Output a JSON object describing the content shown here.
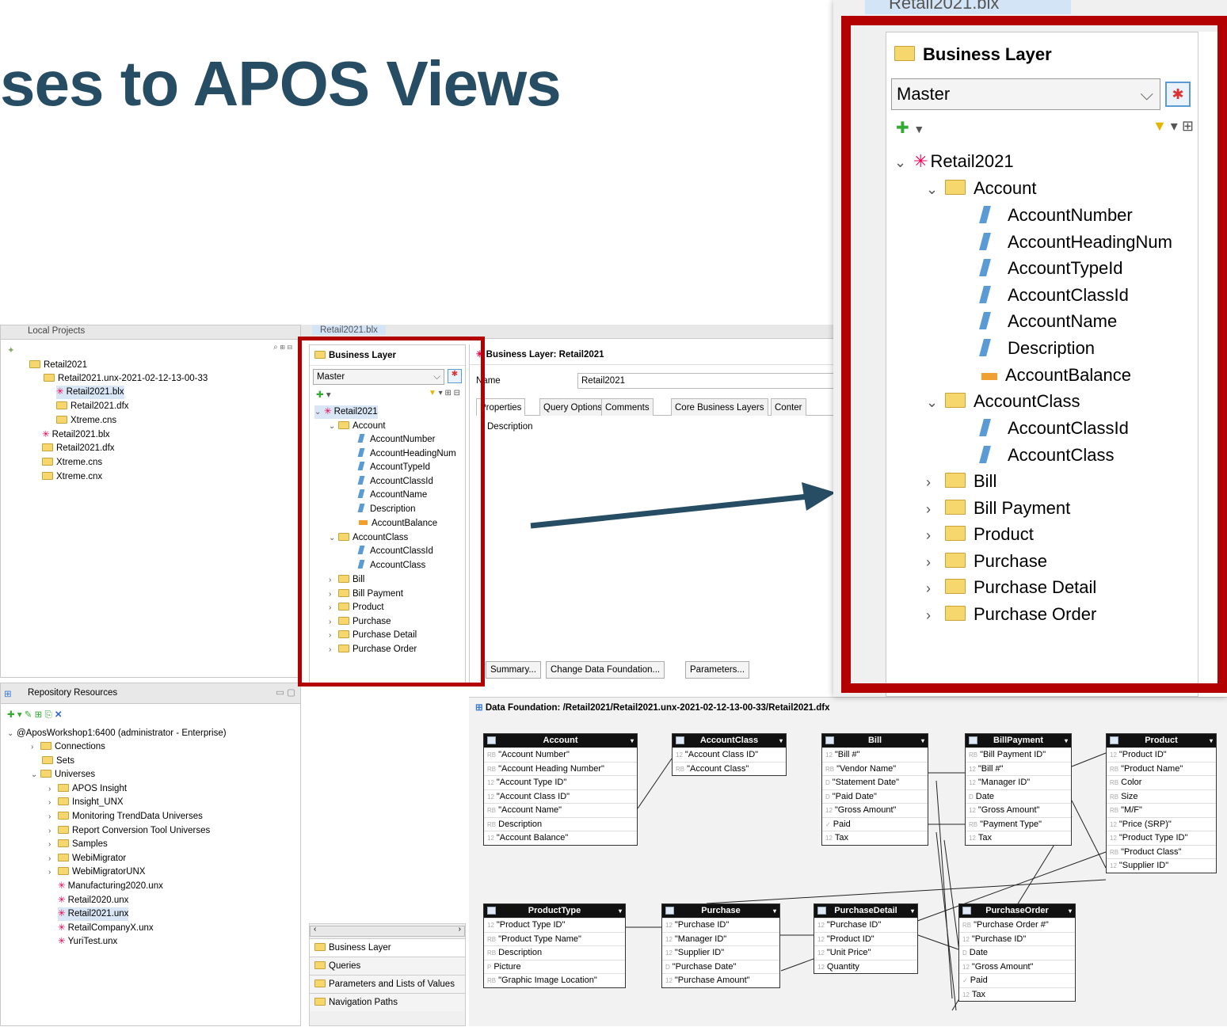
{
  "slide_title": "ses to APOS Views",
  "local_projects": {
    "tab": "Local Projects",
    "items": [
      "Retail2021",
      "Retail2021.unx-2021-02-12-13-00-33",
      "Retail2021.blx",
      "Retail2021.dfx",
      "Xtreme.cns",
      "Retail2021.blx",
      "Retail2021.dfx",
      "Xtreme.cns",
      "Xtreme.cnx"
    ]
  },
  "repo": {
    "tab": "Repository Resources",
    "server": "@AposWorkshop1:6400 (administrator - Enterprise)",
    "items": [
      "Connections",
      "Sets",
      "Universes",
      "APOS Insight",
      "Insight_UNX",
      "Monitoring TrendData Universes",
      "Report Conversion Tool Universes",
      "Samples",
      "WebiMigrator",
      "WebiMigratorUNX",
      "Manufacturing2020.unx",
      "Retail2020.unx",
      "Retail2021.unx",
      "RetailCompanyX.unx",
      "YuriTest.unx"
    ]
  },
  "editor_tab": "Retail2021.blx",
  "bl": {
    "title": "Business Layer",
    "view": "Master",
    "root": "Retail2021",
    "account": "Account",
    "account_items": [
      "AccountNumber",
      "AccountHeadingNum",
      "AccountTypeId",
      "AccountClassId",
      "AccountName",
      "Description",
      "AccountBalance"
    ],
    "accountclass": "AccountClass",
    "accountclass_items": [
      "AccountClassId",
      "AccountClass"
    ],
    "folders": [
      "Bill",
      "Bill Payment",
      "Product",
      "Purchase",
      "Purchase Detail",
      "Purchase Order"
    ]
  },
  "nav": [
    "Business Layer",
    "Queries",
    "Parameters and Lists of Values",
    "Navigation Paths"
  ],
  "props": {
    "header": "Business Layer: Retail2021",
    "name_label": "Name",
    "name_value": "Retail2021",
    "tabs": [
      "Properties",
      "Query Options",
      "Comments",
      "Core Business Layers",
      "Conter"
    ],
    "desc_label": "Description",
    "buttons": [
      "Summary...",
      "Change Data Foundation...",
      "Parameters..."
    ]
  },
  "df": {
    "header": "Data Foundation: /Retail2021/Retail2021.unx-2021-02-12-13-00-33/Retail2021.dfx",
    "tables": [
      {
        "name": "Account",
        "cols": [
          [
            "RB",
            "\"Account Number\""
          ],
          [
            "RB",
            "\"Account Heading Number\""
          ],
          [
            "12",
            "\"Account Type ID\""
          ],
          [
            "12",
            "\"Account Class ID\""
          ],
          [
            "RB",
            "\"Account Name\""
          ],
          [
            "RB",
            "Description"
          ],
          [
            "12",
            "\"Account Balance\""
          ]
        ]
      },
      {
        "name": "AccountClass",
        "cols": [
          [
            "12",
            "\"Account Class ID\""
          ],
          [
            "RB",
            "\"Account Class\""
          ]
        ]
      },
      {
        "name": "Bill",
        "cols": [
          [
            "12",
            "\"Bill #\""
          ],
          [
            "RB",
            "\"Vendor Name\""
          ],
          [
            "D",
            "\"Statement Date\""
          ],
          [
            "D",
            "\"Paid Date\""
          ],
          [
            "12",
            "\"Gross Amount\""
          ],
          [
            "✓",
            "Paid"
          ],
          [
            "12",
            "Tax"
          ]
        ]
      },
      {
        "name": "BillPayment",
        "cols": [
          [
            "RB",
            "\"Bill Payment ID\""
          ],
          [
            "12",
            "\"Bill #\""
          ],
          [
            "12",
            "\"Manager ID\""
          ],
          [
            "D",
            "Date"
          ],
          [
            "12",
            "\"Gross Amount\""
          ],
          [
            "RB",
            "\"Payment Type\""
          ],
          [
            "12",
            "Tax"
          ]
        ]
      },
      {
        "name": "Product",
        "cols": [
          [
            "12",
            "\"Product ID\""
          ],
          [
            "RB",
            "\"Product Name\""
          ],
          [
            "RB",
            "Color"
          ],
          [
            "RB",
            "Size"
          ],
          [
            "RB",
            "\"M/F\""
          ],
          [
            "12",
            "\"Price (SRP)\""
          ],
          [
            "12",
            "\"Product Type ID\""
          ],
          [
            "RB",
            "\"Product Class\""
          ],
          [
            "12",
            "\"Supplier ID\""
          ]
        ]
      },
      {
        "name": "ProductType",
        "cols": [
          [
            "12",
            "\"Product Type ID\""
          ],
          [
            "RB",
            "\"Product Type Name\""
          ],
          [
            "RB",
            "Description"
          ],
          [
            "P",
            "Picture"
          ],
          [
            "RB",
            "\"Graphic Image Location\""
          ]
        ]
      },
      {
        "name": "Purchase",
        "cols": [
          [
            "12",
            "\"Purchase ID\""
          ],
          [
            "12",
            "\"Manager ID\""
          ],
          [
            "12",
            "\"Supplier ID\""
          ],
          [
            "D",
            "\"Purchase Date\""
          ],
          [
            "12",
            "\"Purchase Amount\""
          ]
        ]
      },
      {
        "name": "PurchaseDetail",
        "cols": [
          [
            "12",
            "\"Purchase ID\""
          ],
          [
            "12",
            "\"Product ID\""
          ],
          [
            "12",
            "\"Unit Price\""
          ],
          [
            "12",
            "Quantity"
          ]
        ]
      },
      {
        "name": "PurchaseOrder",
        "cols": [
          [
            "RB",
            "\"Purchase Order #\""
          ],
          [
            "12",
            "\"Purchase ID\""
          ],
          [
            "D",
            "Date"
          ],
          [
            "12",
            "\"Gross Amount\""
          ],
          [
            "✓",
            "Paid"
          ],
          [
            "12",
            "Tax"
          ]
        ]
      }
    ]
  }
}
